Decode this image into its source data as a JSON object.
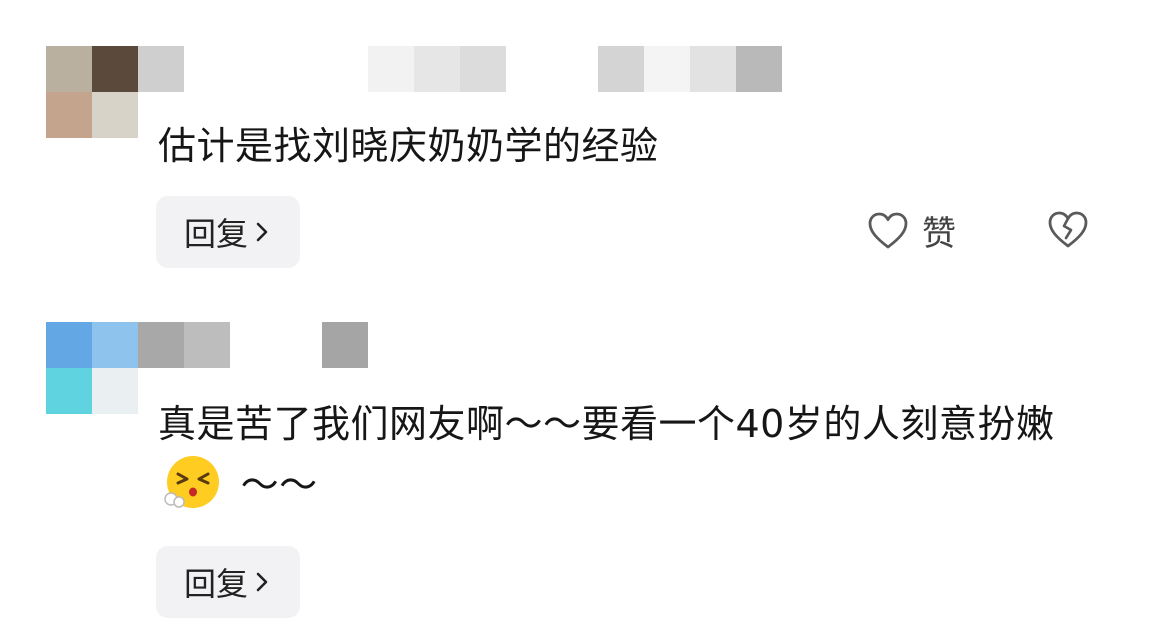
{
  "comments": [
    {
      "text": "估计是找刘晓庆奶奶学的经验",
      "reply_label": "回复",
      "like_label": "赞",
      "avatar_colors": [
        "#b9b09f",
        "#5b4a3b",
        "#c4a48c",
        "#d8d3c8"
      ],
      "username_mosaic_colors": [
        "#cfcfcf",
        "#f2f2f2",
        "#e6e6e6",
        "#dcdcdc",
        "#eeeeee",
        "#d4d4d4",
        "#f4f4f4",
        "#e2e2e2",
        "#b9b9b9"
      ]
    },
    {
      "text_before_emoji": "真是苦了我们网友啊～～要看一个40岁的人刻意扮嫩",
      "text_after_emoji": " ～～",
      "emoji_icon": "face-with-steam-emoji",
      "reply_label": "回复",
      "avatar_colors": [
        "#63a8e4",
        "#8ec3ee",
        "#5fd4e0",
        "#eaf0f2"
      ],
      "username_mosaic_colors": [
        "#a8a8a8",
        "#bdbdbd",
        "#c8c8c8",
        "#e0e0e0",
        "#a5a5a5"
      ]
    }
  ],
  "icons": {
    "like": "heart-outline-icon",
    "dislike": "broken-heart-icon",
    "reply_arrow": "chevron-right-icon"
  }
}
